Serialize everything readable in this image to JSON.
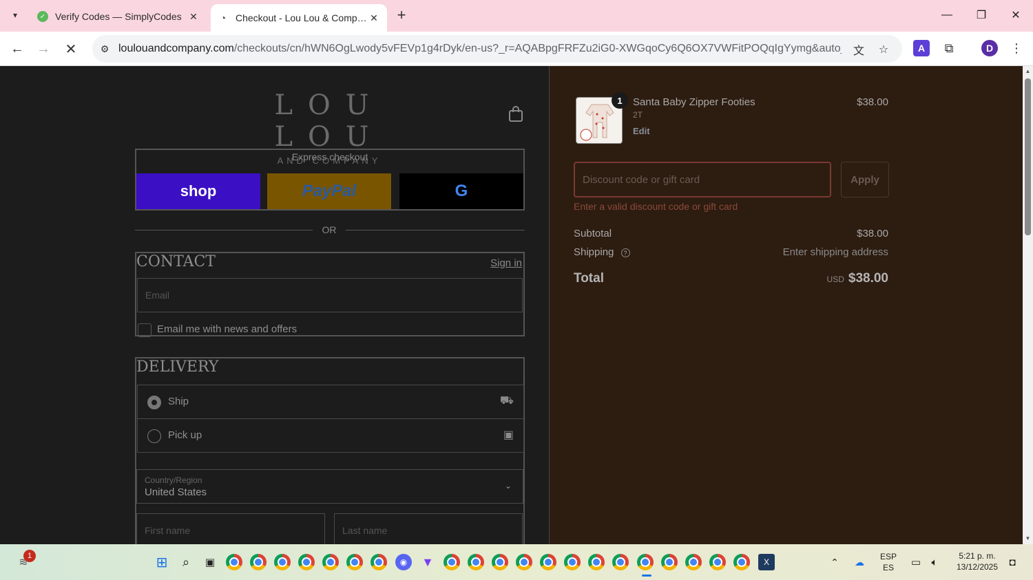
{
  "browser": {
    "tabs": [
      {
        "title": "Verify Codes — SimplyCodes",
        "active": false
      },
      {
        "title": "Checkout - Lou Lou & Company",
        "active": true
      }
    ],
    "url_host": "loulouandcompany.com",
    "url_path": "/checkouts/cn/hWN6OgLwody5vFEVp1g4rDyk/en-us?_r=AQABpgFRFZu2iG0-XWGqoCy6Q6OX7VWFitPOQqIgYymg&auto_redire...",
    "profile_initial": "D"
  },
  "store": {
    "logo_main": "LOU LOU",
    "logo_sub": "AND COMPANY"
  },
  "express": {
    "title": "Express checkout",
    "shop_label": "shop",
    "paypal_label": "PayPal",
    "gpay_label": "G"
  },
  "or_label": "OR",
  "contact": {
    "title": "CONTACT",
    "sign_in": "Sign in",
    "email_placeholder": "Email",
    "newsletter_label": "Email me with news and offers"
  },
  "delivery": {
    "title": "DELIVERY",
    "options": [
      {
        "label": "Ship",
        "selected": true
      },
      {
        "label": "Pick up",
        "selected": false
      }
    ],
    "country_label": "Country/Region",
    "country_value": "United States",
    "first_name_placeholder": "First name",
    "last_name_placeholder": "Last name"
  },
  "order": {
    "item": {
      "quantity": "1",
      "name": "Santa Baby Zipper Footies",
      "variant": "2T",
      "edit": "Edit",
      "price": "$38.00"
    },
    "discount_placeholder": "Discount code or gift card",
    "apply": "Apply",
    "discount_error": "Enter a valid discount code or gift card",
    "subtotal_label": "Subtotal",
    "subtotal_value": "$38.00",
    "shipping_label": "Shipping",
    "shipping_value": "Enter shipping address",
    "total_label": "Total",
    "total_currency": "USD",
    "total_value": "$38.00"
  },
  "taskbar": {
    "notification_count": "1",
    "lang_top": "ESP",
    "lang_bottom": "ES",
    "time": "5:21 p. m.",
    "date": "13/12/2025"
  },
  "colors": {
    "tabbar": "#fad6e0",
    "shop": "#3b0fc4",
    "paypal": "#7a5500",
    "right_pane": "#2d1c10",
    "error": "#8a4a3a"
  }
}
